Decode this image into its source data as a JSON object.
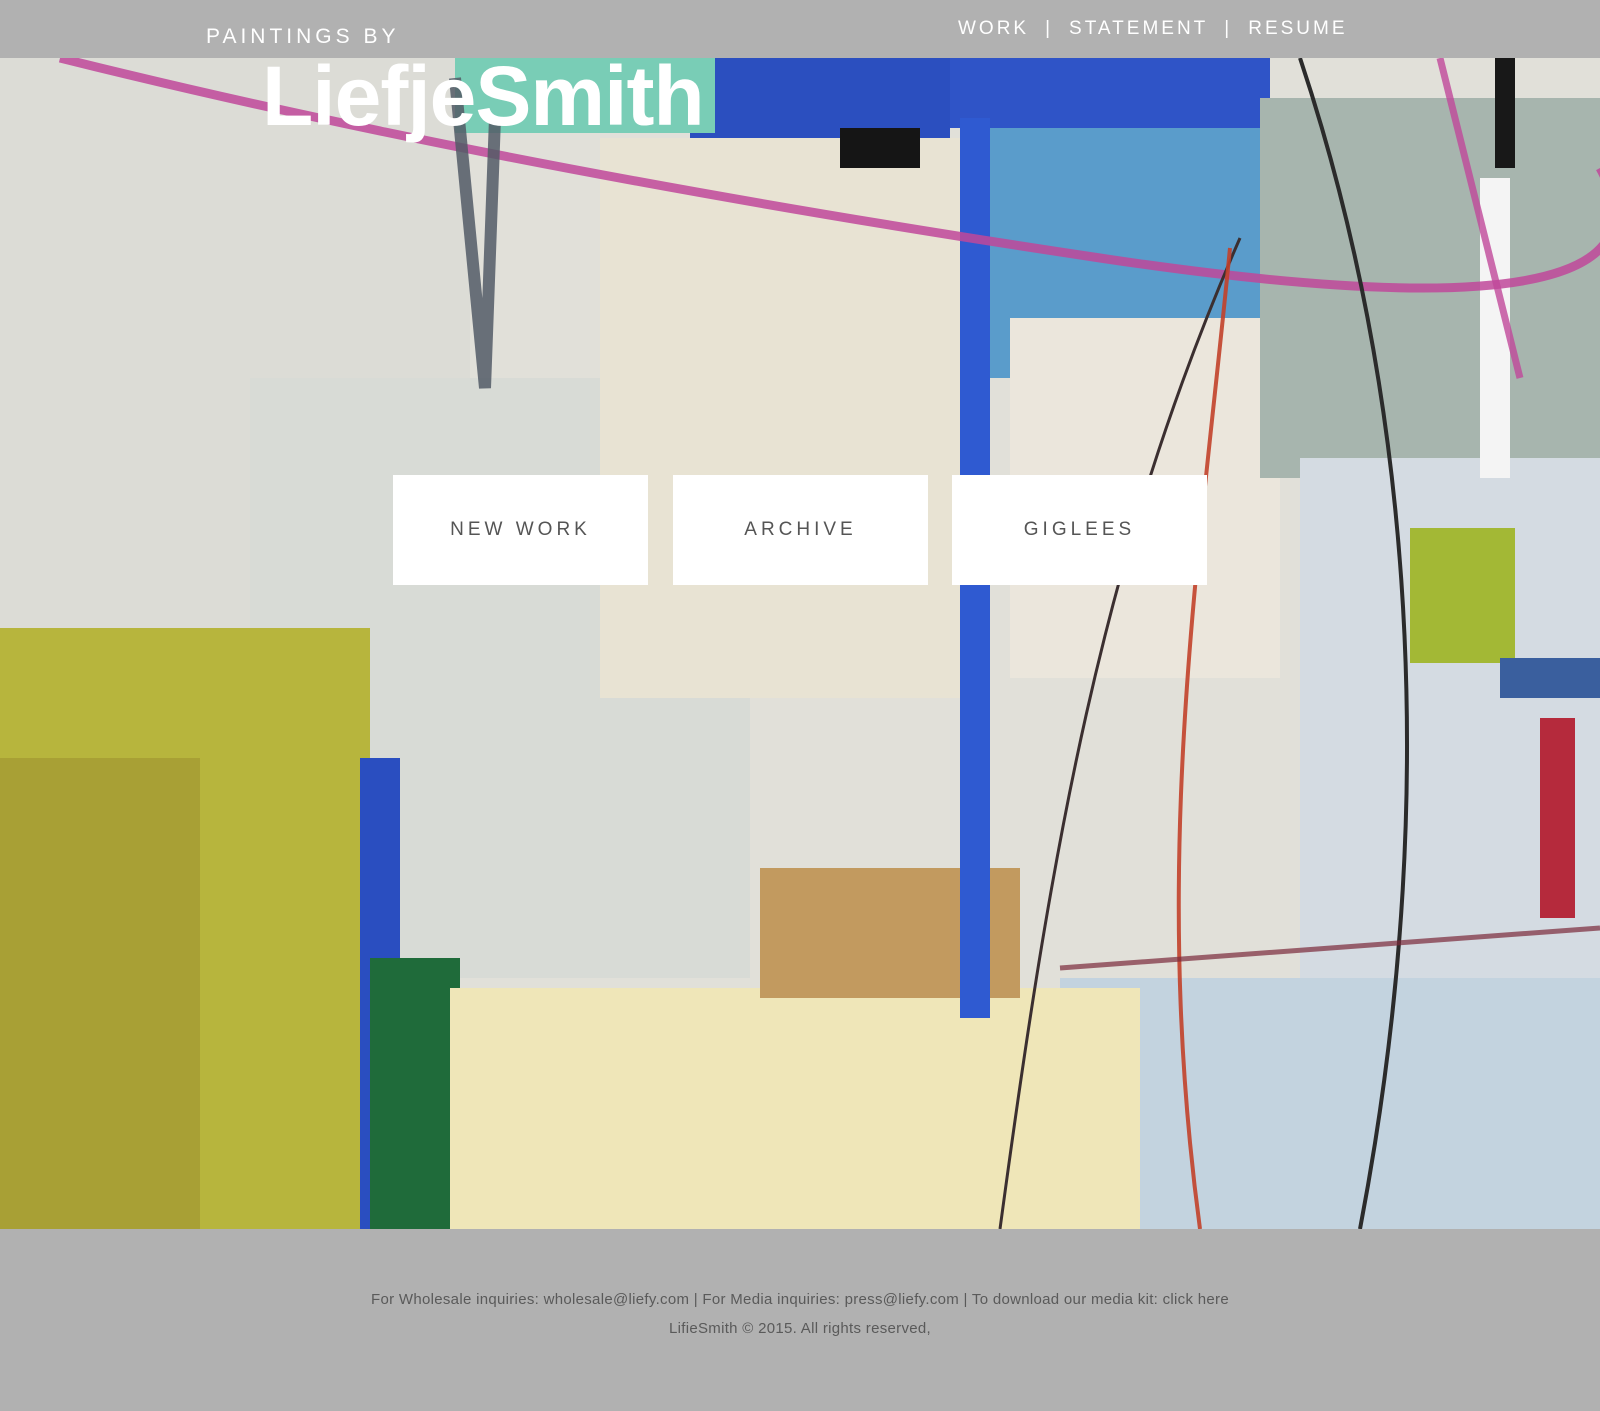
{
  "header": {
    "tagline": "PAINTINGS BY",
    "brand": "LiefjeSmith",
    "nav": [
      {
        "label": "WORK"
      },
      {
        "label": "STATEMENT"
      },
      {
        "label": "RESUME"
      }
    ],
    "nav_separator": "|"
  },
  "hero": {
    "image": "abstract-painting-background",
    "buttons": [
      {
        "label": "NEW WORK"
      },
      {
        "label": "ARCHIVE"
      },
      {
        "label": "GIGLEES"
      }
    ]
  },
  "footer": {
    "line1": "For Wholesale inquiries: wholesale@liefy.com | For Media inquiries: press@liefy.com |  To download our media kit: click here",
    "line2": "LifieSmith ©  2015.  All rights reserved,"
  },
  "colors": {
    "bar_gray": "#b1b1b1",
    "button_bg": "#ffffff",
    "button_text": "#555555",
    "footer_text": "#5a5a5a"
  }
}
